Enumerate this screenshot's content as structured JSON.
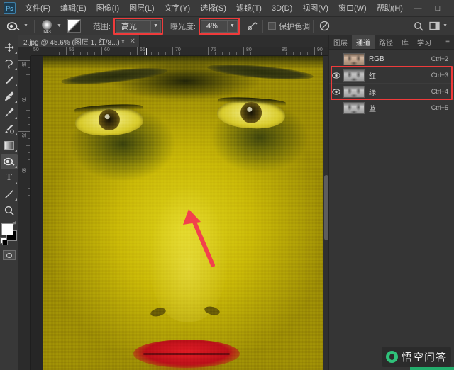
{
  "app": {
    "logo_text": "Ps"
  },
  "menubar": {
    "items": [
      {
        "label": "文件(F)"
      },
      {
        "label": "编辑(E)"
      },
      {
        "label": "图像(I)"
      },
      {
        "label": "图层(L)"
      },
      {
        "label": "文字(Y)"
      },
      {
        "label": "选择(S)"
      },
      {
        "label": "滤镜(T)"
      },
      {
        "label": "3D(D)"
      },
      {
        "label": "视图(V)"
      },
      {
        "label": "窗口(W)"
      },
      {
        "label": "帮助(H)"
      }
    ],
    "window_controls": {
      "minimize": "—",
      "maximize": "□",
      "close": "✕"
    }
  },
  "options_bar": {
    "tool_icon": "dodge-tool-icon",
    "brush_size": "143",
    "range_label": "范围:",
    "range_value": "高光",
    "exposure_label": "曝光度:",
    "exposure_value": "4%",
    "airbrush_icon": "airbrush-icon",
    "protect_tones_label": "保护色调",
    "pressure_icon": "pressure-for-size-icon",
    "search_icon": "search-icon",
    "workspace_icon": "workspace-switcher-icon"
  },
  "toolbar": {
    "tools": [
      {
        "name": "move-tool",
        "glyph": "✥"
      },
      {
        "name": "lasso-tool",
        "glyph": "✂"
      },
      {
        "name": "healing-brush-tool",
        "glyph": "✒"
      },
      {
        "name": "eyedropper-tool",
        "glyph": "🖉"
      },
      {
        "name": "brush-tool",
        "glyph": "🖌"
      },
      {
        "name": "clone-stamp-tool",
        "glyph": "✎"
      },
      {
        "name": "gradient-tool",
        "glyph": "▤"
      },
      {
        "name": "dodge-tool",
        "glyph": "◕"
      },
      {
        "name": "type-tool",
        "glyph": "T"
      },
      {
        "name": "line-tool",
        "glyph": "╱"
      },
      {
        "name": "zoom-tool",
        "glyph": "⚲"
      }
    ],
    "foreground_color": "#ffffff",
    "background_color": "#000000"
  },
  "document_tab": {
    "title": "2.jpg @ 45.6% (图层 1, 红/8...) *",
    "close_glyph": "✕"
  },
  "rulers": {
    "horizontal_labels": [
      "50",
      "55",
      "60",
      "65",
      "70",
      "75",
      "80",
      "85",
      "90"
    ],
    "vertical_labels": [
      "65",
      "70",
      "75",
      "80"
    ]
  },
  "canvas": {
    "annotation": "red-arrow-pointing-up-left",
    "annotation_color": "#ef3b3b"
  },
  "right_panel": {
    "tabs": [
      {
        "label": "图层",
        "active": false
      },
      {
        "label": "通道",
        "active": true
      },
      {
        "label": "路径",
        "active": false
      },
      {
        "label": "库",
        "active": false
      },
      {
        "label": "学习",
        "active": false
      }
    ],
    "panel_menu_glyph": "≡",
    "channels": [
      {
        "name": "RGB",
        "shortcut": "Ctrl+2",
        "visible": false,
        "highlighted": false
      },
      {
        "name": "红",
        "shortcut": "Ctrl+3",
        "visible": true,
        "highlighted": true
      },
      {
        "name": "绿",
        "shortcut": "Ctrl+4",
        "visible": true,
        "highlighted": true
      },
      {
        "name": "蓝",
        "shortcut": "Ctrl+5",
        "visible": false,
        "highlighted": false
      }
    ],
    "eye_glyph": "👁"
  },
  "watermark": {
    "text": "悟空问答",
    "accent_color": "#2fc27a"
  }
}
